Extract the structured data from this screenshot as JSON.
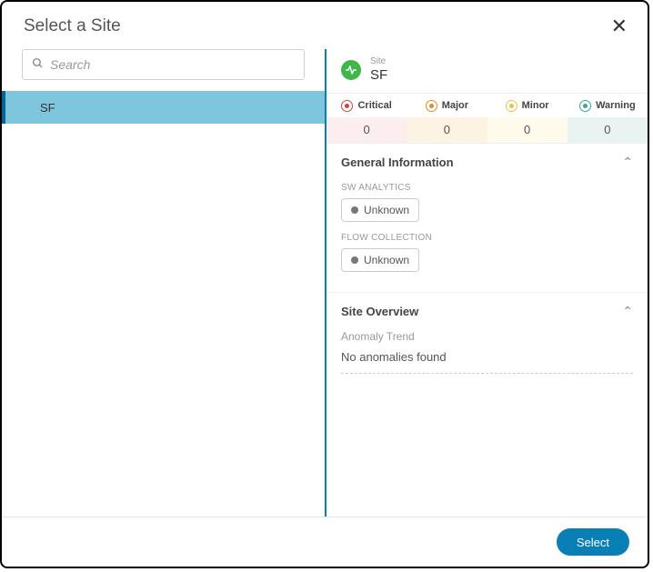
{
  "dialog": {
    "title": "Select a Site",
    "select_button": "Select"
  },
  "search": {
    "placeholder": "Search"
  },
  "sites": [
    {
      "name": "SF",
      "selected": true
    }
  ],
  "detail": {
    "site_kind_label": "Site",
    "site_name": "SF",
    "severity": [
      {
        "label": "Critical",
        "value": "0",
        "class": "sev-critical"
      },
      {
        "label": "Major",
        "value": "0",
        "class": "sev-major"
      },
      {
        "label": "Minor",
        "value": "0",
        "class": "sev-minor"
      },
      {
        "label": "Warning",
        "value": "0",
        "class": "sev-warning"
      }
    ],
    "general": {
      "title": "General Information",
      "sw_analytics": {
        "label": "SW ANALYTICS",
        "value": "Unknown"
      },
      "flow_collection": {
        "label": "FLOW COLLECTION",
        "value": "Unknown"
      }
    },
    "overview": {
      "title": "Site Overview",
      "anomaly_trend_label": "Anomaly Trend",
      "anomaly_trend_text": "No anomalies found"
    }
  }
}
